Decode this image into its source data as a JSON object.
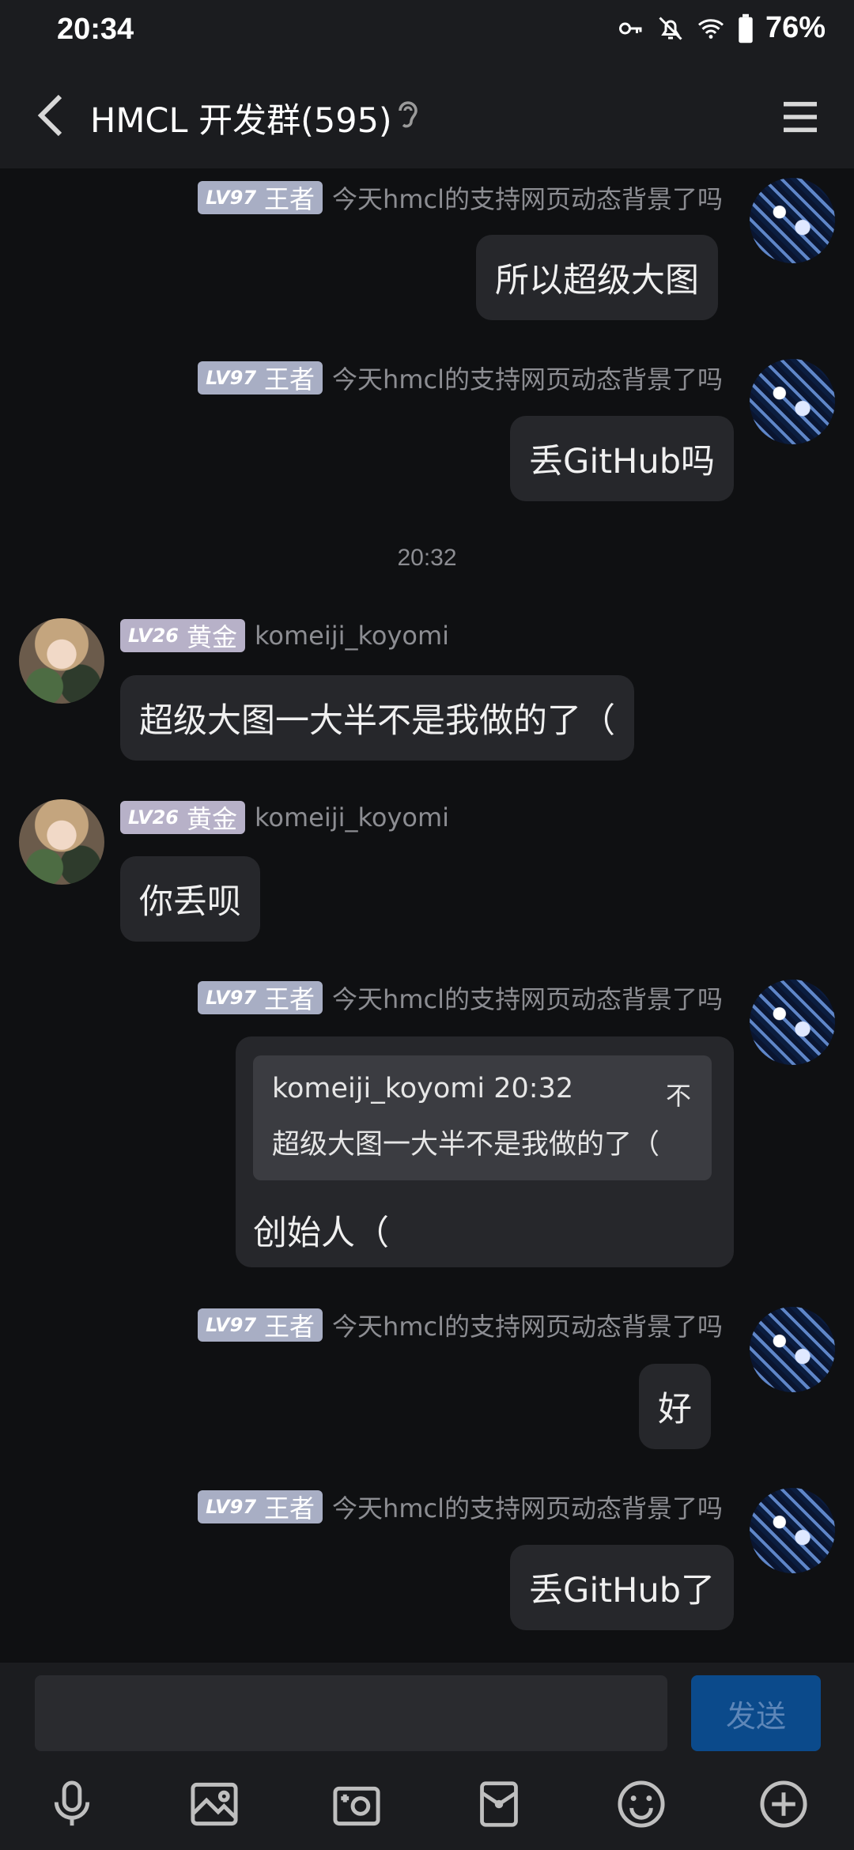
{
  "status_bar": {
    "time": "20:34",
    "battery": "76%",
    "icons": [
      "vpn-key-icon",
      "bell-off-icon",
      "wifi-icon",
      "battery-icon"
    ]
  },
  "header": {
    "title": "HMCL 开发群(595)",
    "back_icon": "chevron-left-icon",
    "ear_icon": "ear-icon",
    "menu_icon": "hamburger-menu-icon"
  },
  "messages": [
    {
      "side": "right",
      "level": "LV97",
      "rank": "王者",
      "sender": "今天hmcl的支持网页动态背景了吗",
      "text": "所以超级大图"
    },
    {
      "side": "right",
      "level": "LV97",
      "rank": "王者",
      "sender": "今天hmcl的支持网页动态背景了吗",
      "text": "丢GitHub吗"
    },
    {
      "timestamp": "20:32"
    },
    {
      "side": "left",
      "level": "LV26",
      "rank": "黄金",
      "sender": "komeiji_koyomi",
      "text": "超级大图一大半不是我做的了（"
    },
    {
      "side": "left",
      "level": "LV26",
      "rank": "黄金",
      "sender": "komeiji_koyomi",
      "text": "你丢呗"
    },
    {
      "side": "right",
      "level": "LV97",
      "rank": "王者",
      "sender": "今天hmcl的支持网页动态背景了吗",
      "quote": {
        "header": "komeiji_koyomi 20:32",
        "icon_label": "不",
        "text": "超级大图一大半不是我做的了（"
      },
      "text": "创始人（"
    },
    {
      "side": "right",
      "level": "LV97",
      "rank": "王者",
      "sender": "今天hmcl的支持网页动态背景了吗",
      "text": "好"
    },
    {
      "side": "right",
      "level": "LV97",
      "rank": "王者",
      "sender": "今天hmcl的支持网页动态背景了吗",
      "text": "丢GitHub了"
    }
  ],
  "input": {
    "value": "",
    "send_label": "发送"
  },
  "toolbar": {
    "tools": [
      "microphone-icon",
      "image-icon",
      "camera-icon",
      "red-packet-icon",
      "emoji-icon",
      "plus-circle-icon"
    ]
  },
  "colors": {
    "background": "#0f1012",
    "bar": "#1b1c1f",
    "bubble": "#26272b",
    "badge": "#a8aec4",
    "send_button": "#0b4a8b"
  }
}
